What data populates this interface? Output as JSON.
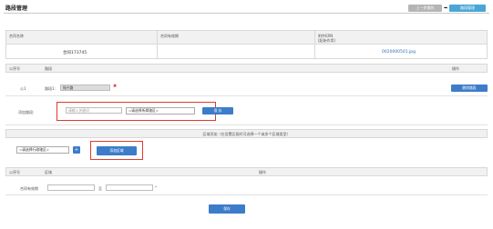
{
  "page": {
    "title": "路段管理"
  },
  "top_nav": {
    "prev_label": "上一步操作",
    "current_label": "路段管理",
    "arrow": "➡"
  },
  "contract": {
    "headers": [
      "合同名称",
      "合同有效期",
      "附件ERN\n(起始作用)"
    ],
    "values": [
      "合同173745",
      "",
      "0020000501.jpg"
    ]
  },
  "road_section": {
    "headers": {
      "index": "公序号",
      "road": "路段",
      "ops": "操作"
    },
    "row": {
      "index": "公1",
      "road_label": "路段1:",
      "road_tag": "振兴路",
      "delete_label": "删除路段"
    },
    "add_label": "添加路段:",
    "road_input_placeholder": "请输入关键词",
    "district_select": "=请选择所属辖区=",
    "save_label": "保 存"
  },
  "region_add": {
    "note": "区域添加（在设置区段时可选择一个或多个区域类型）",
    "select": "=请选择行政辖区=",
    "plus": "+",
    "add_label": "添加区域"
  },
  "validity": {
    "headers": {
      "index": "公序号",
      "region": "区域",
      "ops": "操作"
    },
    "label": "合同有效期",
    "sep": "至",
    "star": "*"
  },
  "footer": {
    "save_label": "保存"
  }
}
